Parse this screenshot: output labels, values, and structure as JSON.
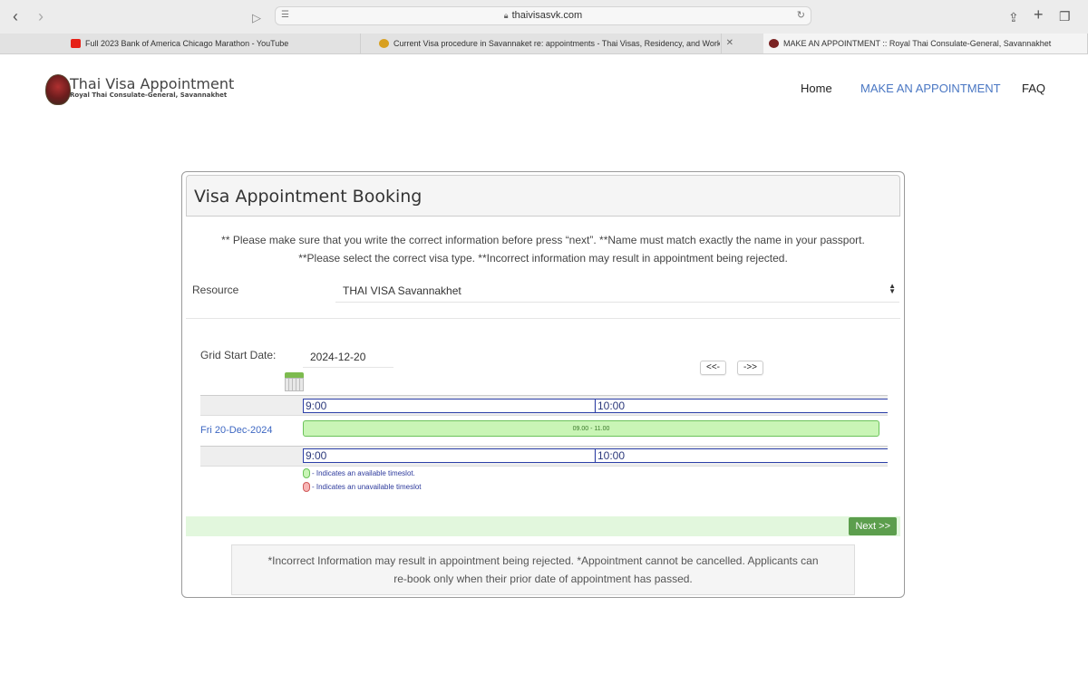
{
  "browser": {
    "url": "thaivisasvk.com",
    "tabs": [
      {
        "title": "Full 2023 Bank of America Chicago Marathon - YouTube",
        "icon": "youtube-icon"
      },
      {
        "title": "Current Visa procedure in Savannaket re: appointments - Thai Visas, Residency, and Work...",
        "icon": "forum-icon"
      },
      {
        "title": "MAKE AN APPOINTMENT :: Royal Thai Consulate-General, Savannakhet",
        "icon": "consulate-icon"
      }
    ]
  },
  "site": {
    "logo_title": "Thai Visa Appointment",
    "logo_subtitle": "Royal Thai Consulate-General, Savannakhet",
    "nav": {
      "home": "Home",
      "appointment": "MAKE AN APPOINTMENT",
      "faq": "FAQ"
    }
  },
  "booking": {
    "title": "Visa Appointment Booking",
    "notice_line1": "** Please make sure that you write the correct information before press “next”. **Name must match exactly the name in your passport.",
    "notice_line2": "**Please select the correct visa type. **Incorrect information may result in appointment being rejected.",
    "resource_label": "Resource",
    "resource_value": "THAI VISA Savannakhet",
    "grid_start_label": "Grid Start Date:",
    "grid_start_value": "2024-12-20",
    "prev_label": "<<-",
    "next_grid_label": "->>",
    "slots": [
      "9:00",
      "10:00"
    ],
    "date_label": "Fri 20-Dec-2024",
    "available_range": "09.00 - 11.00",
    "legend_available": "- Indicates an available timeslot.",
    "legend_unavailable": "- Indicates an unavailable timeslot",
    "next_button": "Next >>",
    "footer_line1": "*Incorrect Information may result in appointment being rejected. *Appointment cannot be cancelled. Applicants can",
    "footer_line2": "re-book only when their prior date of appointment has passed."
  },
  "colors": {
    "link_blue": "#4a77c3",
    "slot_border": "#2c3fa8",
    "available_green": "#c9f5b6",
    "next_green": "#5c9e4d"
  }
}
